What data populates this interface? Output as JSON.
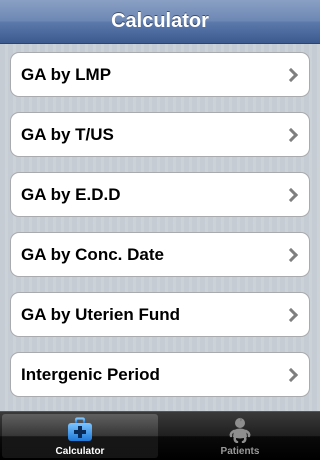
{
  "nav": {
    "title": "Calculator"
  },
  "menu": {
    "items": [
      {
        "label": "GA by LMP"
      },
      {
        "label": "GA by T/US"
      },
      {
        "label": "GA by E.D.D"
      },
      {
        "label": "GA by Conc. Date"
      },
      {
        "label": "GA by Uterien Fund"
      },
      {
        "label": "Intergenic Period"
      }
    ]
  },
  "tab_bar": {
    "tabs": [
      {
        "label": "Calculator",
        "icon": "first-aid-kit-icon",
        "selected": true
      },
      {
        "label": "Patients",
        "icon": "baby-icon",
        "selected": false
      }
    ]
  },
  "colors": {
    "nav_bar": "#5c79ab",
    "background": "#c5ccd4",
    "tab_bar": "#1f1f1f",
    "tab_icon_selected": "#3d9be9",
    "tab_icon_unselected": "#8e8e8e"
  }
}
